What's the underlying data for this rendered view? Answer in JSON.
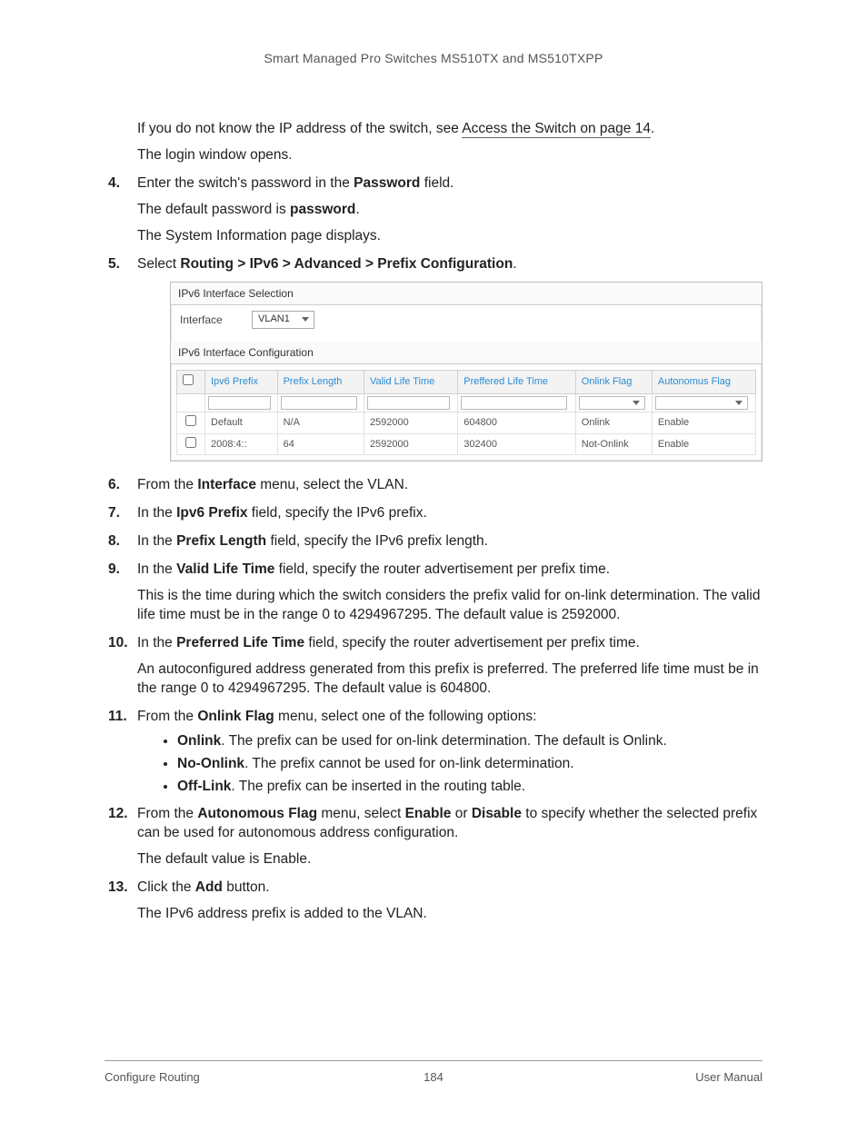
{
  "header": {
    "title": "Smart Managed Pro Switches MS510TX and MS510TXPP"
  },
  "intro": {
    "line1a": "If you do not know the IP address of the switch, see ",
    "link": "Access the Switch on page 14",
    "line1b": ".",
    "line2": "The login window opens."
  },
  "steps": {
    "s4": {
      "main_a": "Enter the switch's password in the ",
      "main_b": "Password",
      "main_c": " field.",
      "sub1_a": "The default password is ",
      "sub1_b": "password",
      "sub1_c": ".",
      "sub2": "The System Information page displays."
    },
    "s5": {
      "a": "Select ",
      "b": "Routing > IPv6 > Advanced > Prefix Configuration",
      "c": "."
    },
    "s6": {
      "a": "From the ",
      "b": "Interface",
      "c": " menu, select the VLAN."
    },
    "s7": {
      "a": "In the ",
      "b": "Ipv6 Prefix",
      "c": " field, specify the IPv6 prefix."
    },
    "s8": {
      "a": "In the ",
      "b": "Prefix Length",
      "c": " field, specify the IPv6 prefix length."
    },
    "s9": {
      "a": "In the ",
      "b": "Valid Life Time",
      "c": " field, specify the router advertisement per prefix time.",
      "sub": "This is the time during which the switch considers the prefix valid for on-link determination. The valid life time must be in the range 0 to 4294967295. The default value is 2592000."
    },
    "s10": {
      "a": "In the ",
      "b": "Preferred Life Time",
      "c": " field, specify the router advertisement per prefix time.",
      "sub": "An autoconfigured address generated from this prefix is preferred. The preferred life time must be in the range 0 to 4294967295. The default value is 604800."
    },
    "s11": {
      "a": "From the ",
      "b": "Onlink Flag",
      "c": " menu, select one of the following options:",
      "bullets": [
        {
          "b": "Onlink",
          "t": ". The prefix can be used for on-link determination. The default is Onlink."
        },
        {
          "b": "No-Onlink",
          "t": ". The prefix cannot be used for on-link determination."
        },
        {
          "b": "Off-Link",
          "t": ". The prefix can be inserted in the routing table."
        }
      ]
    },
    "s12": {
      "a": "From the ",
      "b": "Autonomous Flag",
      "c": " menu, select ",
      "d": "Enable",
      "e": " or ",
      "f": "Disable",
      "g": " to specify whether the selected prefix can be used for autonomous address configuration.",
      "sub": "The default value is Enable."
    },
    "s13": {
      "a": "Click the ",
      "b": "Add",
      "c": " button.",
      "sub": "The IPv6 address prefix is added to the VLAN."
    }
  },
  "panel": {
    "section1_title": "IPv6 Interface Selection",
    "interface_label": "Interface",
    "interface_value": "VLAN1",
    "section2_title": "IPv6 Interface Configuration",
    "columns": [
      "Ipv6 Prefix",
      "Prefix Length",
      "Valid Life Time",
      "Preffered Life Time",
      "Onlink Flag",
      "Autonomus Flag"
    ],
    "rows": [
      {
        "prefix": "Default",
        "len": "N/A",
        "valid": "2592000",
        "pref": "604800",
        "onlink": "Onlink",
        "auto": "Enable"
      },
      {
        "prefix": "2008:4::",
        "len": "64",
        "valid": "2592000",
        "pref": "302400",
        "onlink": "Not-Onlink",
        "auto": "Enable"
      }
    ]
  },
  "footer": {
    "left": "Configure Routing",
    "center": "184",
    "right": "User Manual"
  }
}
